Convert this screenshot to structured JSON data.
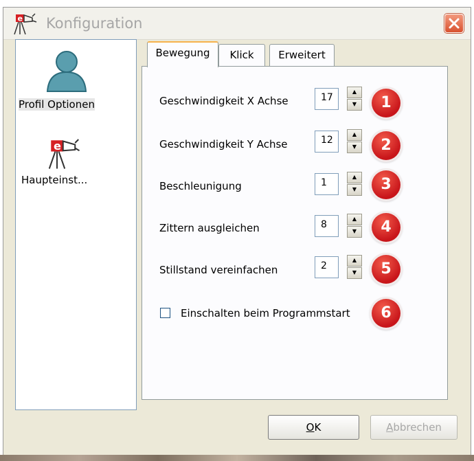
{
  "window": {
    "title": "Konfiguration"
  },
  "sidebar": {
    "items": [
      {
        "label": "Profil Optionen",
        "icon": "user-icon",
        "selected": true
      },
      {
        "label": "Haupteinst...",
        "icon": "app-icon",
        "selected": false
      }
    ]
  },
  "tabs": [
    {
      "label": "Bewegung",
      "active": true
    },
    {
      "label": "Klick",
      "active": false
    },
    {
      "label": "Erweitert",
      "active": false
    }
  ],
  "settings": [
    {
      "label": "Geschwindigkeit X Achse",
      "value": "17",
      "badge": "1"
    },
    {
      "label": "Geschwindigkeit Y Achse",
      "value": "12",
      "badge": "2"
    },
    {
      "label": "Beschleunigung",
      "value": "1",
      "badge": "3"
    },
    {
      "label": "Zittern ausgleichen",
      "value": "8",
      "badge": "4"
    },
    {
      "label": "Stillstand vereinfachen",
      "value": "2",
      "badge": "5"
    }
  ],
  "checkbox": {
    "label": "Einschalten beim Programmstart",
    "checked": false,
    "badge": "6"
  },
  "buttons": {
    "ok": "OK",
    "cancel": "Abbrechen",
    "ok_mnemonic": "O",
    "cancel_mnemonic": "A"
  },
  "colors": {
    "badge": "#c8151a",
    "titlebar_text": "#a6a6a6",
    "close_button": "#d8512f",
    "active_tab_accent": "#f7b24c"
  }
}
